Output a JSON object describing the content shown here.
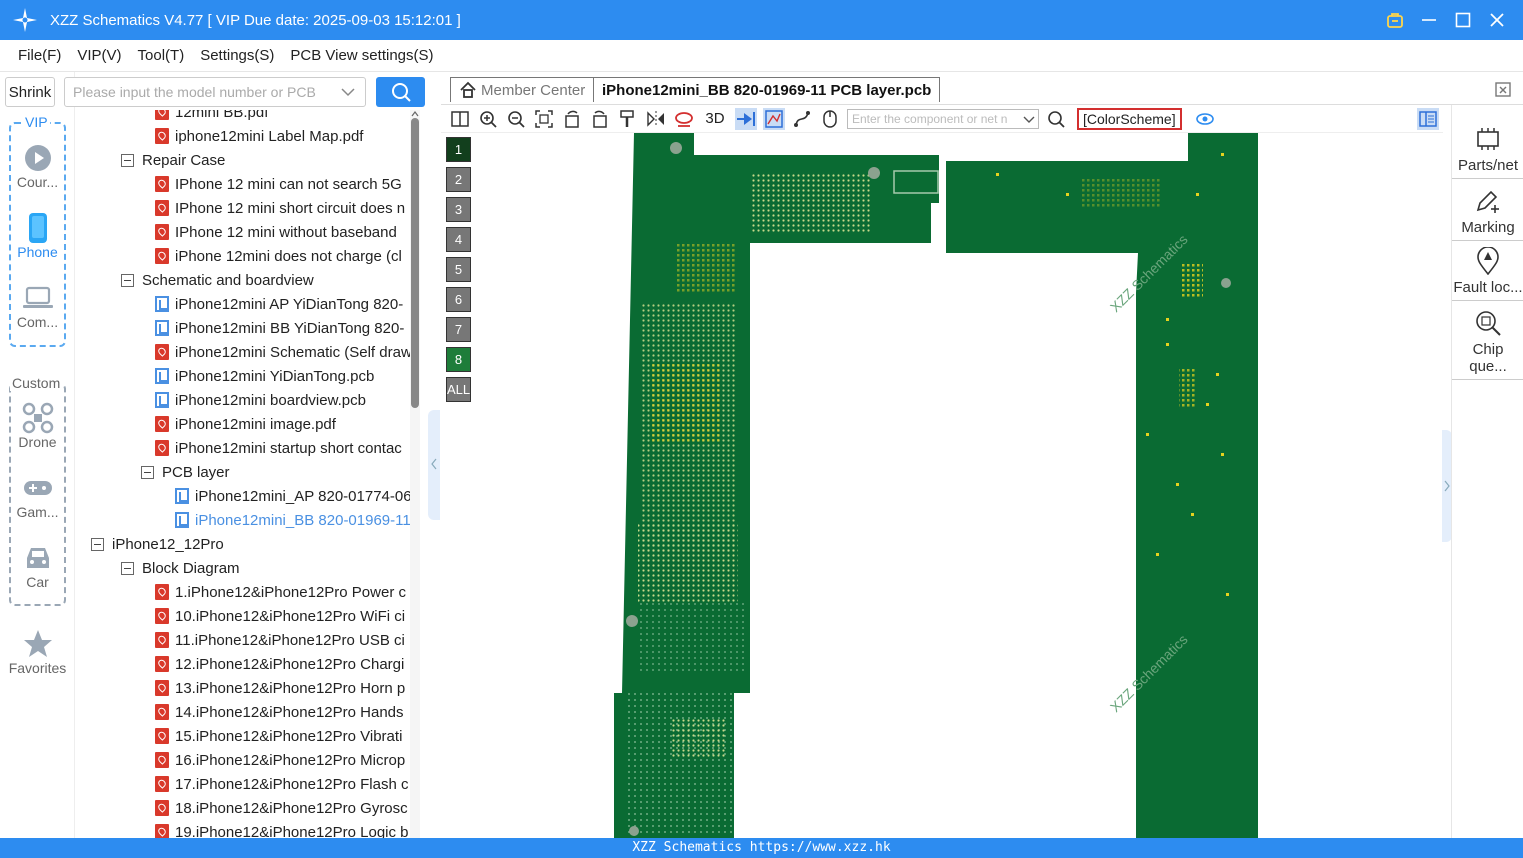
{
  "window": {
    "title": "XZZ Schematics V4.77 [ VIP Due date: 2025-09-03 15:12:01 ]"
  },
  "menu": [
    "File(F)",
    "VIP(V)",
    "Tool(T)",
    "Settings(S)",
    "PCB View settings(S)"
  ],
  "left_panel": {
    "shrink_label": "Shrink",
    "search_placeholder": "Please input the model number or PCB"
  },
  "rail": {
    "vip_label": "VIP",
    "custom_label": "Custom",
    "items": [
      {
        "label": "Cour...",
        "icon": "play-icon"
      },
      {
        "label": "Phone",
        "icon": "phone-icon"
      },
      {
        "label": "Com...",
        "icon": "laptop-icon"
      },
      {
        "label": "Drone",
        "icon": "drone-icon"
      },
      {
        "label": "Gam...",
        "icon": "gamepad-icon"
      },
      {
        "label": "Car",
        "icon": "car-icon"
      },
      {
        "label": "Favorites",
        "icon": "star-icon"
      }
    ]
  },
  "tree": [
    {
      "text": "12mini BB.pdf",
      "type": "pdf",
      "level": 2
    },
    {
      "text": "iphone12mini Label Map.pdf",
      "type": "pdf",
      "level": 2
    },
    {
      "text": "Repair Case",
      "type": "folder",
      "level": 1
    },
    {
      "text": "IPhone 12 mini can not search 5G",
      "type": "pdf",
      "level": 2
    },
    {
      "text": "IPhone 12 mini short circuit does n",
      "type": "pdf",
      "level": 2
    },
    {
      "text": "IPhone 12 mini without baseband",
      "type": "pdf",
      "level": 2
    },
    {
      "text": "iPhone 12mini does not charge (cl",
      "type": "pdf",
      "level": 2
    },
    {
      "text": "Schematic and boardview",
      "type": "folder",
      "level": 1
    },
    {
      "text": "iPhone12mini AP YiDianTong 820-",
      "type": "pcb",
      "level": 2
    },
    {
      "text": "iPhone12mini BB YiDianTong 820-",
      "type": "pcb",
      "level": 2
    },
    {
      "text": "iPhone12mini Schematic (Self draw",
      "type": "pdf",
      "level": 2
    },
    {
      "text": "iPhone12mini YiDianTong.pcb",
      "type": "pcb",
      "level": 2
    },
    {
      "text": "iPhone12mini boardview.pcb",
      "type": "pcb",
      "level": 2
    },
    {
      "text": "iPhone12mini image.pdf",
      "type": "pdf",
      "level": 2
    },
    {
      "text": "iPhone12mini startup short contac",
      "type": "pdf",
      "level": 2
    },
    {
      "text": "PCB layer",
      "type": "folder",
      "level": 2
    },
    {
      "text": "iPhone12mini_AP 820-01774-06",
      "type": "pcb",
      "level": 3
    },
    {
      "text": "iPhone12mini_BB 820-01969-11",
      "type": "pcb",
      "level": 3,
      "selected": true
    },
    {
      "text": "iPhone12_12Pro",
      "type": "folder",
      "level": 0
    },
    {
      "text": "Block Diagram",
      "type": "folder",
      "level": 1
    },
    {
      "text": "1.iPhone12&iPhone12Pro Power c",
      "type": "pdf",
      "level": 2
    },
    {
      "text": "10.iPhone12&iPhone12Pro WiFi ci",
      "type": "pdf",
      "level": 2
    },
    {
      "text": "11.iPhone12&iPhone12Pro USB ci",
      "type": "pdf",
      "level": 2
    },
    {
      "text": "12.iPhone12&iPhone12Pro Chargi",
      "type": "pdf",
      "level": 2
    },
    {
      "text": "13.iPhone12&iPhone12Pro Horn p",
      "type": "pdf",
      "level": 2
    },
    {
      "text": "14.iPhone12&iPhone12Pro Hands",
      "type": "pdf",
      "level": 2
    },
    {
      "text": "15.iPhone12&iPhone12Pro Vibrati",
      "type": "pdf",
      "level": 2
    },
    {
      "text": "16.iPhone12&iPhone12Pro Microp",
      "type": "pdf",
      "level": 2
    },
    {
      "text": "17.iPhone12&iPhone12Pro Flash c",
      "type": "pdf",
      "level": 2
    },
    {
      "text": "18.iPhone12&iPhone12Pro Gyrosc",
      "type": "pdf",
      "level": 2
    },
    {
      "text": "19.iPhone12&iPhone12Pro Logic b",
      "type": "pdf",
      "level": 2
    }
  ],
  "tabs": {
    "member_center": "Member Center",
    "active": "iPhone12mini_BB 820-01969-11 PCB layer.pcb"
  },
  "toolbar": {
    "three_d": "3D",
    "component_placeholder": "Enter the component or net n",
    "color_scheme": "[ColorScheme]"
  },
  "layers": [
    "1",
    "2",
    "3",
    "4",
    "5",
    "6",
    "7",
    "8",
    "ALL"
  ],
  "board": {
    "watermark": "XZZ Schematics"
  },
  "right_tools": [
    "Parts/net",
    "Marking",
    "Fault loc...",
    "Chip que..."
  ],
  "status": "XZZ Schematics https://www.xzz.hk",
  "colors": {
    "accent": "#2d8cf0",
    "board_green": "#0a6b33",
    "pad_yellow": "#e6d21e",
    "selected_layer": "#1e7d3a"
  }
}
